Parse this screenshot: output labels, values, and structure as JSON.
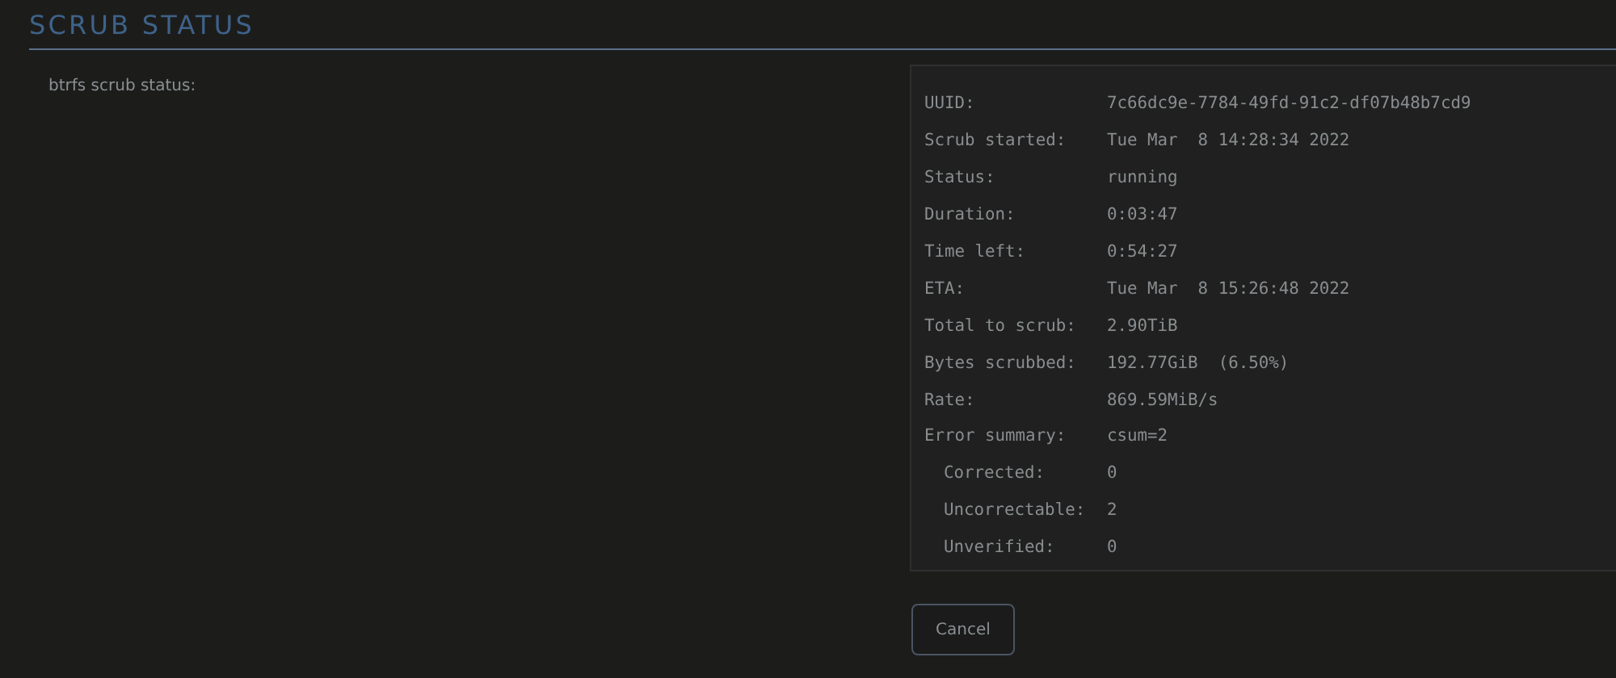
{
  "title": "SCRUB STATUS",
  "field_label": "btrfs scrub status:",
  "status_rows": [
    {
      "label": "UUID:",
      "value": "7c66dc9e-7784-49fd-91c2-df07b48b7cd9"
    },
    {
      "label": "Scrub started:",
      "value": "Tue Mar  8 14:28:34 2022"
    },
    {
      "label": "Status:",
      "value": "running"
    },
    {
      "label": "Duration:",
      "value": "0:03:47"
    },
    {
      "label": "Time left:",
      "value": "0:54:27"
    },
    {
      "label": "ETA:",
      "value": "Tue Mar  8 15:26:48 2022"
    },
    {
      "label": "Total to scrub:",
      "value": "2.90TiB"
    },
    {
      "label": "Bytes scrubbed:",
      "value": "192.77GiB  (6.50%)"
    },
    {
      "label": "Rate:",
      "value": "869.59MiB/s"
    },
    {
      "label": "Error summary:",
      "value": "csum=2",
      "children": [
        {
          "label": "Corrected:",
          "value": "0"
        },
        {
          "label": "Uncorrectable:",
          "value": "2"
        },
        {
          "label": "Unverified:",
          "value": "0"
        }
      ]
    }
  ],
  "buttons": [
    "Cancel"
  ]
}
